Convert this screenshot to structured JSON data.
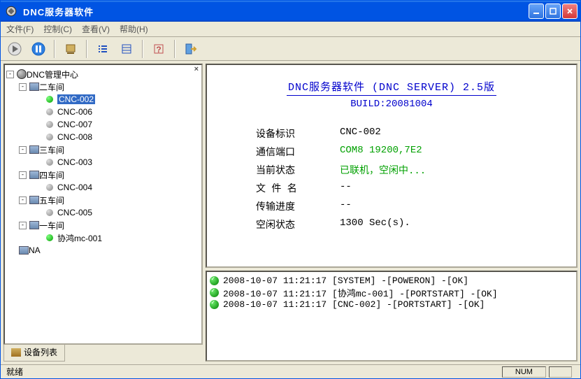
{
  "window": {
    "title": "DNC服务器软件"
  },
  "menu": {
    "file": "文件(F)",
    "control": "控制(C)",
    "view": "查看(V)",
    "help": "帮助(H)"
  },
  "tree": {
    "root": "DNC管理中心",
    "workshops": [
      {
        "name": "二车间",
        "nodes": [
          {
            "name": "CNC-002",
            "status": "green",
            "selected": true
          },
          {
            "name": "CNC-006",
            "status": "gray"
          },
          {
            "name": "CNC-007",
            "status": "gray"
          },
          {
            "name": "CNC-008",
            "status": "gray"
          }
        ]
      },
      {
        "name": "三车间",
        "nodes": [
          {
            "name": "CNC-003",
            "status": "gray"
          }
        ]
      },
      {
        "name": "四车间",
        "nodes": [
          {
            "name": "CNC-004",
            "status": "gray"
          }
        ]
      },
      {
        "name": "五车间",
        "nodes": [
          {
            "name": "CNC-005",
            "status": "gray"
          }
        ]
      },
      {
        "name": "一车间",
        "nodes": [
          {
            "name": "协鸿mc-001",
            "status": "green"
          }
        ]
      }
    ],
    "na": "NA"
  },
  "tab": {
    "label": "设备列表"
  },
  "info": {
    "title": "DNC服务器软件 (DNC SERVER) 2.5版",
    "build": "BUILD:20081004",
    "rows": {
      "device_id_k": "设备标识",
      "device_id_v": "CNC-002",
      "port_k": "通信端口",
      "port_v": "COM8 19200,7E2",
      "status_k": "当前状态",
      "status_v": "已联机，空闲中...",
      "file_k": "文 件 名",
      "file_v": "--",
      "progress_k": "传输进度",
      "progress_v": "--",
      "idle_k": "空闲状态",
      "idle_v": "1300 Sec(s)."
    }
  },
  "log": [
    "2008-10-07 11:21:17 [SYSTEM] -[POWERON] -[OK]",
    "2008-10-07 11:21:17 [协鸿mc-001] -[PORTSTART] -[OK]",
    "2008-10-07 11:21:17 [CNC-002] -[PORTSTART] -[OK]"
  ],
  "status": {
    "ready": "就绪",
    "num": "NUM"
  }
}
